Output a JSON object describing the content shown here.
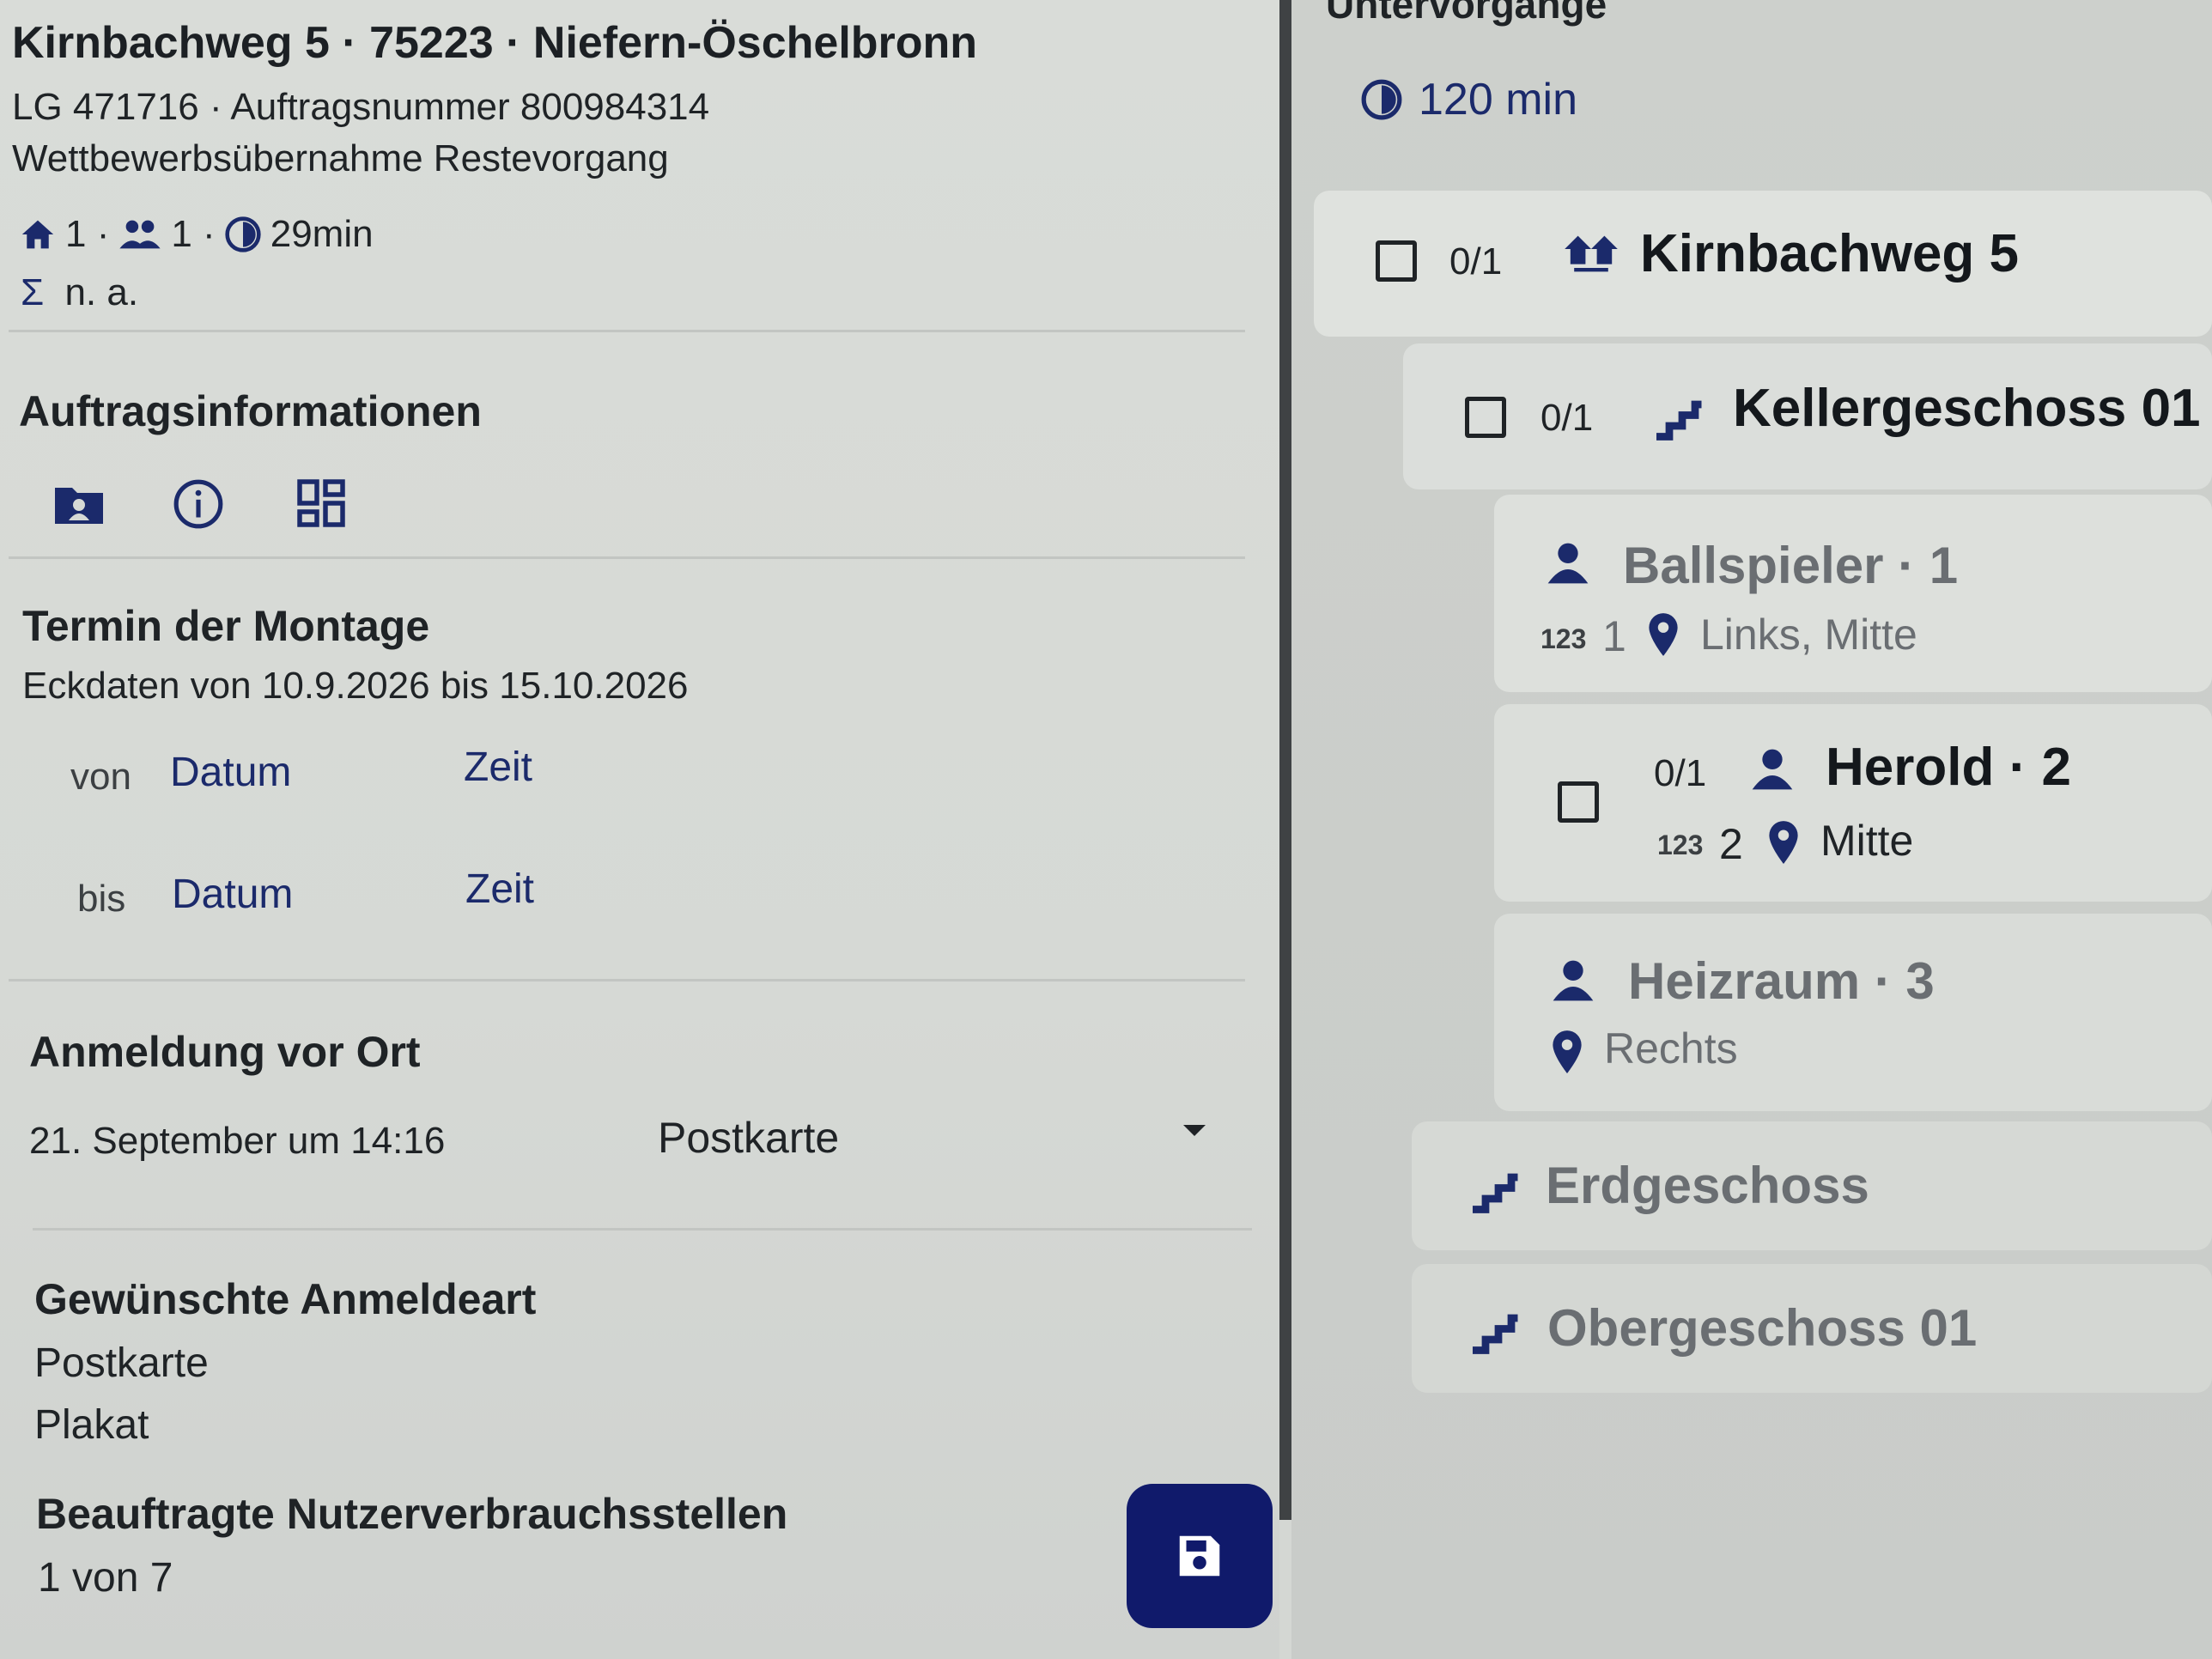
{
  "header": {
    "address": "Kirnbachweg 5 · 75223 · Niefern-Öschelbronn",
    "order_line": "LG 471716 · Auftragsnummer 800984314",
    "order_type": "Wettbewerbsübernahme Restevorgang",
    "stats": {
      "houses": "1 ·",
      "persons": "1 ·",
      "duration": "29min"
    },
    "sum_label": "Σ",
    "sum_value": "n. a."
  },
  "auftragsinfo": {
    "title": "Auftragsinformationen",
    "icons": [
      "contact-folder-icon",
      "info-icon",
      "dashboard-icon"
    ]
  },
  "termin": {
    "title": "Termin der Montage",
    "eckdaten": "Eckdaten von 10.9.2026 bis 15.10.2026",
    "von_label": "von",
    "bis_label": "bis",
    "date_placeholder": "Datum",
    "time_placeholder": "Zeit"
  },
  "anmeldung": {
    "title": "Anmeldung vor Ort",
    "datetime": "21. September um 14:16",
    "method_selected": "Postkarte"
  },
  "gewuenschte": {
    "title": "Gewünschte Anmeldeart",
    "options": [
      "Postkarte",
      "Plakat"
    ]
  },
  "nutzer": {
    "title": "Beauftragte Nutzerverbrauchsstellen",
    "value": "1 von 7"
  },
  "right": {
    "title": "Untervorgänge",
    "duration": "120 min",
    "building": {
      "count": "0/1",
      "label": "Kirnbachweg 5"
    },
    "floor_keller": {
      "count": "0/1",
      "label": "Kellergeschoss 01"
    },
    "ballspieler": {
      "label": "Ballspieler · 1",
      "num_icon": "123",
      "num": "1",
      "location": "Links, Mitte"
    },
    "herold": {
      "count": "0/1",
      "label": "Herold · 2",
      "num_icon": "123",
      "num": "2",
      "location": "Mitte"
    },
    "heizraum": {
      "label": "Heizraum · 3",
      "location": "Rechts"
    },
    "erdgeschoss": "Erdgeschoss",
    "obergeschoss": "Obergeschoss 01"
  },
  "colors": {
    "navy": "#1b2a6b",
    "fab": "#101a6b",
    "muted": "#6a6e72"
  }
}
